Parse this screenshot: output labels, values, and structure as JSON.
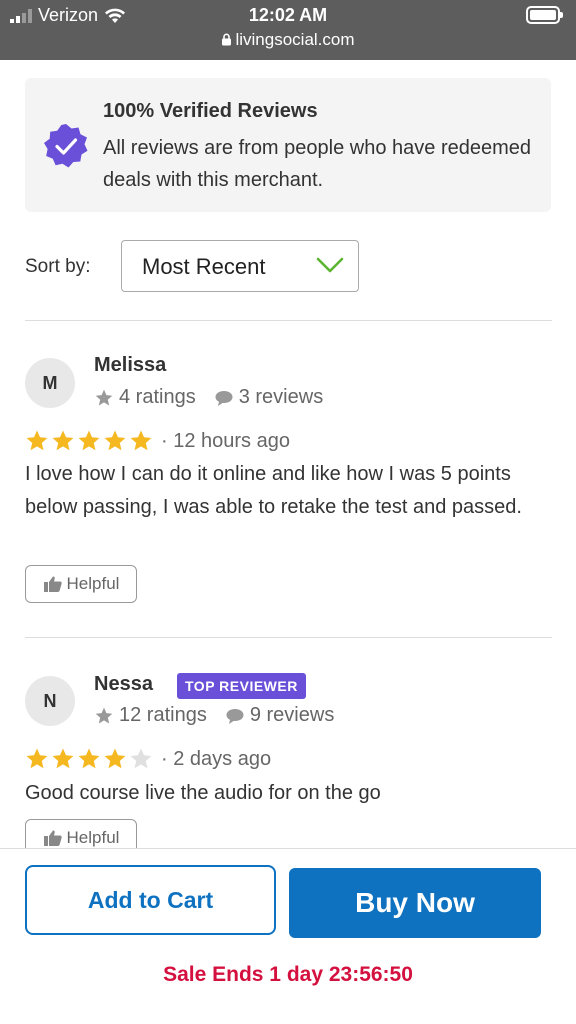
{
  "status_bar": {
    "carrier": "Verizon",
    "time": "12:02 AM",
    "url": "livingsocial.com"
  },
  "verified": {
    "title": "100% Verified Reviews",
    "text": "All reviews are from people who have redeemed deals with this merchant."
  },
  "sort": {
    "label": "Sort by:",
    "value": "Most Recent"
  },
  "reviews": [
    {
      "initial": "M",
      "name": "Melissa",
      "ratings": "4 ratings",
      "reviews": "3 reviews",
      "stars": 5,
      "time": "· 12 hours ago",
      "text": "I love how I can do it online and like how I was 5 points below passing, I was able to retake the test and passed.",
      "helpful": "Helpful"
    },
    {
      "initial": "N",
      "name": "Nessa",
      "badge": "TOP REVIEWER",
      "ratings": "12 ratings",
      "reviews": "9 reviews",
      "stars": 4,
      "time": "· 2 days ago",
      "text": "Good course live the audio for on the go",
      "helpful": "Helpful"
    }
  ],
  "actions": {
    "add_to_cart": "Add to Cart",
    "buy_now": "Buy Now",
    "sale": "Sale Ends 1 day 23:56:50"
  },
  "colors": {
    "primary": "#0f72c0",
    "star": "#f5b821",
    "star_empty": "#e0e0e0",
    "badge": "#6a4fd9",
    "sale": "#d4103f"
  }
}
